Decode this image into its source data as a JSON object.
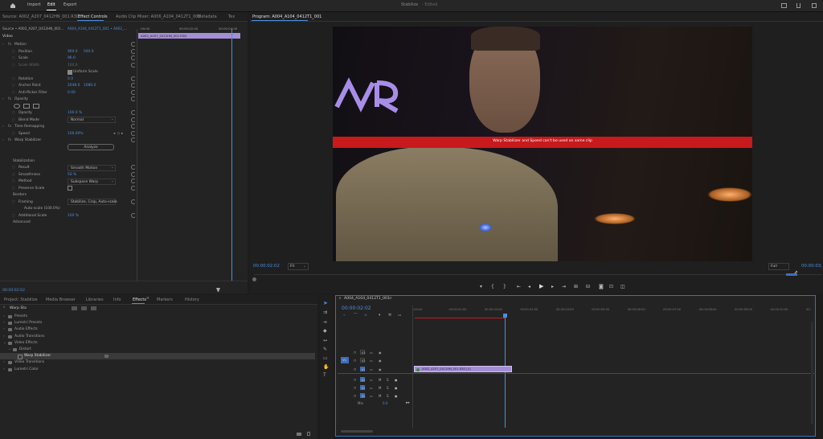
{
  "topbar": {
    "nav": [
      "Import",
      "Edit",
      "Export"
    ],
    "active_nav": "Edit",
    "title": "Stabilize",
    "edited": "- Edited"
  },
  "left_tabs": [
    "Source: A002_A207_0412HN_001.R3D",
    "Effect Controls",
    "Audio Clip Mixer: A006_A104_0412T1_001",
    "Metadata",
    "Tex"
  ],
  "ec": {
    "source": "Source • A002_A207_0412HN_001...",
    "sequence": "A004_A104_0412T1_001 • A002_...",
    "tc_start": ":00:00",
    "tc_mid": "00:00:02:00",
    "tc_end": "00:00:04:00",
    "clip": "A002_A207_0412HN_001.R3D",
    "video_header": "Video",
    "rows": [
      {
        "label": "Motion",
        "type": "group"
      },
      {
        "label": "Position",
        "v1": "960.0",
        "v2": "540.0"
      },
      {
        "label": "Scale",
        "v1": "96.0"
      },
      {
        "label": "Scale Width",
        "v1": "100.0",
        "dim": true
      },
      {
        "label": "Uniform Scale",
        "type": "check"
      },
      {
        "label": "Rotation",
        "v1": "0.0"
      },
      {
        "label": "Anchor Point",
        "v1": "2048.0",
        "v2": "1080.0"
      },
      {
        "label": "Anti-flicker Filter",
        "v1": "0.00"
      },
      {
        "label": "Opacity",
        "type": "group"
      },
      {
        "label": "",
        "type": "shapes"
      },
      {
        "label": "Opacity",
        "v1": "100.0 %"
      },
      {
        "label": "Blend Mode",
        "select": "Normal"
      },
      {
        "label": "Time Remapping",
        "type": "group"
      },
      {
        "label": "Speed",
        "v1": "100.00%"
      },
      {
        "label": "Warp Stabilizer",
        "type": "group"
      },
      {
        "label": "",
        "button": "Analyze"
      },
      {
        "label": "",
        "type": "blank"
      },
      {
        "label": "Stabilization",
        "type": "sub"
      },
      {
        "label": "Result",
        "select": "Smooth Motion"
      },
      {
        "label": "Smoothness",
        "v1": "50 %"
      },
      {
        "label": "Method",
        "select": "Subspace Warp"
      },
      {
        "label": "Preserve Scale",
        "type": "check2"
      },
      {
        "label": "Borders",
        "type": "sub"
      },
      {
        "label": "Framing",
        "select": "Stabilize, Crop, Auto-scale"
      },
      {
        "label": "Auto-scale (100.0%)",
        "type": "plain"
      },
      {
        "label": "Additional Scale",
        "v1": "100 %"
      },
      {
        "label": "Advanced",
        "type": "sub"
      }
    ],
    "bottom_tc": "00:00:02:02"
  },
  "program": {
    "title": "Program: A004_A104_0412T1_001",
    "banner": "Warp Stabilizer and Speed can't be used on same clip",
    "tc": "00:00:02:02",
    "fit": "Fit",
    "quality": "Full",
    "tc_right": "00:00:03:"
  },
  "proj_tabs": [
    "Project: Stabilize",
    "Media Browser",
    "Libraries",
    "Info",
    "Effects",
    "Markers",
    "History"
  ],
  "effects": {
    "search": "Warp Sta",
    "tree": [
      {
        "label": "Presets",
        "indent": 0
      },
      {
        "label": "Lumetri Presets",
        "indent": 0
      },
      {
        "label": "Audio Effects",
        "indent": 0
      },
      {
        "label": "Audio Transitions",
        "indent": 0
      },
      {
        "label": "Video Effects",
        "indent": 0
      },
      {
        "label": "Distort",
        "indent": 1
      },
      {
        "label": "Warp Stabilizer",
        "indent": 2,
        "selected": true
      },
      {
        "label": "Video Transitions",
        "indent": 0
      },
      {
        "label": "Lumetri Color",
        "indent": 0
      }
    ]
  },
  "timeline": {
    "sequence": "A004_A104_0412T1_001",
    "tc": "00:00:02:02",
    "ruler": [
      ":00:00",
      "00:00:01:00",
      "00:00:02:00",
      "00:00:03:00",
      "00:00:04:00",
      "00:00:05:00",
      "00:00:06:00",
      "00:00:07:00",
      "00:00:08:00",
      "00:00:09:00",
      "00:00:10:00",
      "00:"
    ],
    "tracks": [
      "V3",
      "V2",
      "V1",
      "A1",
      "A2",
      "A3"
    ],
    "source_v": "V1",
    "mix": "Mix",
    "mix_val": "0.0",
    "clip": "A002_A207_0412HN_001.R3D [V]"
  },
  "colors": {
    "accent": "#4a8fe0",
    "banner": "#c8191c",
    "clip_purple": "#a48fd6",
    "playhead": "#4a8fe0",
    "bg": "#1d1d1d"
  }
}
